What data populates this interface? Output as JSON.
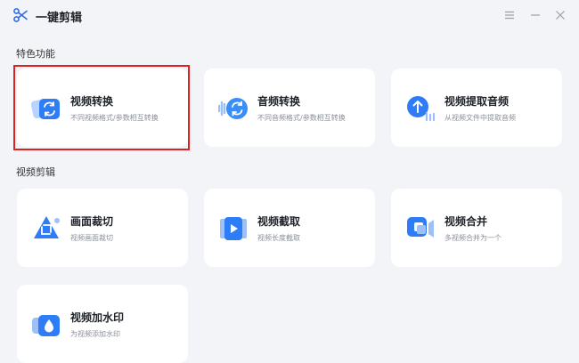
{
  "app": {
    "title": "一键剪辑"
  },
  "sections": {
    "featured": "特色功能",
    "video_edit": "视频剪辑"
  },
  "cards": {
    "video_convert": {
      "title": "视频转换",
      "desc": "不同视频格式/参数相互转换"
    },
    "audio_convert": {
      "title": "音频转换",
      "desc": "不同音频格式/参数相互转换"
    },
    "extract_audio": {
      "title": "视频提取音频",
      "desc": "从视频文件中提取音频"
    },
    "crop": {
      "title": "画面裁切",
      "desc": "视频画面裁切"
    },
    "trim": {
      "title": "视频截取",
      "desc": "视频长度截取"
    },
    "merge": {
      "title": "视频合并",
      "desc": "多视频合并为一个"
    },
    "watermark": {
      "title": "视频加水印",
      "desc": "为视频添加水印"
    }
  },
  "colors": {
    "accent": "#2e7cf6",
    "highlight": "#e02020"
  }
}
